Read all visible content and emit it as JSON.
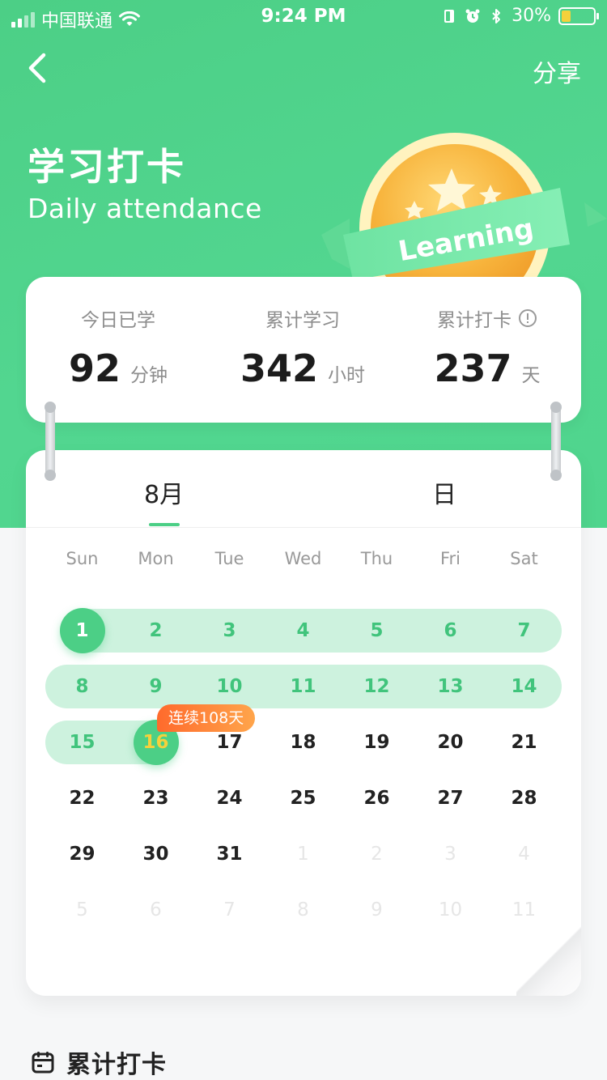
{
  "status_bar": {
    "carrier": "中国联通",
    "time": "9:24 PM",
    "battery": "30%",
    "battery_level": 0.3
  },
  "nav": {
    "back_icon": "chevron-left-icon",
    "share_label": "分享"
  },
  "header": {
    "title": "学习打卡",
    "subtitle": "Daily attendance",
    "medal_text": "Learning"
  },
  "stats": [
    {
      "label": "今日已学",
      "value": "92",
      "unit": "分钟"
    },
    {
      "label": "累计学习",
      "value": "342",
      "unit": "小时"
    },
    {
      "label": "累计打卡",
      "value": "237",
      "unit": "天"
    }
  ],
  "calendar": {
    "tabs": [
      "8月",
      "日"
    ],
    "active_tab": 0,
    "weekdays": [
      "Sun",
      "Mon",
      "Tue",
      "Wed",
      "Thu",
      "Fri",
      "Sat"
    ],
    "weeks": [
      [
        "1",
        "2",
        "3",
        "4",
        "5",
        "6",
        "7"
      ],
      [
        "8",
        "9",
        "10",
        "11",
        "12",
        "13",
        "14"
      ],
      [
        "15",
        "16",
        "17",
        "18",
        "19",
        "20",
        "21"
      ],
      [
        "22",
        "23",
        "24",
        "25",
        "26",
        "27",
        "28"
      ],
      [
        "29",
        "30",
        "31",
        "1",
        "2",
        "3",
        "4"
      ],
      [
        "5",
        "6",
        "7",
        "8",
        "9",
        "10",
        "11"
      ]
    ],
    "streak_badge": "连续108天"
  },
  "footer": {
    "title": "累计打卡"
  },
  "colors": {
    "brand_green": "#4ccf86",
    "stripe_green": "#cdf2de",
    "today_yellow": "#f5d13c",
    "streak_orange": "#ff7a30"
  }
}
